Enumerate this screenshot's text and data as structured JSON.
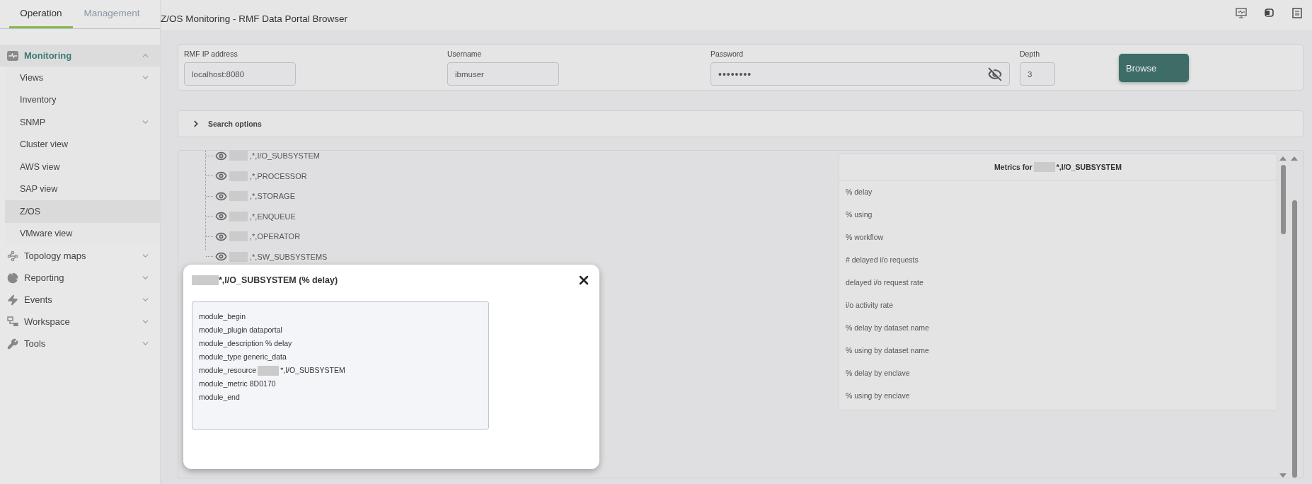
{
  "sidebar": {
    "tabs": [
      {
        "label": "Operation",
        "selected": true
      },
      {
        "label": "Management",
        "selected": false
      }
    ],
    "sections": [
      {
        "label": "Monitoring",
        "expanded": true,
        "children": [
          {
            "label": "Views",
            "has_children": true,
            "selected": false
          },
          {
            "label": "Inventory",
            "has_children": false,
            "selected": false
          },
          {
            "label": "SNMP",
            "has_children": true,
            "selected": false
          },
          {
            "label": "Cluster view",
            "has_children": false,
            "selected": false
          },
          {
            "label": "AWS view",
            "has_children": false,
            "selected": false
          },
          {
            "label": "SAP view",
            "has_children": false,
            "selected": false
          },
          {
            "label": "Z/OS",
            "has_children": false,
            "selected": true
          },
          {
            "label": "VMware view",
            "has_children": false,
            "selected": false
          }
        ]
      },
      {
        "label": "Topology maps",
        "expanded": false
      },
      {
        "label": "Reporting",
        "expanded": false
      },
      {
        "label": "Events",
        "expanded": false
      },
      {
        "label": "Workspace",
        "expanded": false
      },
      {
        "label": "Tools",
        "expanded": false
      }
    ]
  },
  "page_title": "Z/OS Monitoring - RMF Data Portal Browser",
  "form": {
    "fields": [
      {
        "label": "RMF IP address",
        "value": "localhost:8080",
        "kind": "text"
      },
      {
        "label": "Username",
        "value": "ibmuser",
        "kind": "text"
      },
      {
        "label": "Password",
        "value": "••••••••",
        "kind": "password"
      },
      {
        "label": "Depth",
        "value": "3",
        "kind": "number"
      }
    ],
    "button": "Browse"
  },
  "search_options": {
    "label": "Search options",
    "expanded": false
  },
  "tree": [
    {
      "label": ",*,I/O_SUBSYSTEM",
      "redacted": true
    },
    {
      "label": ",*,PROCESSOR",
      "redacted": true
    },
    {
      "label": ",*,STORAGE",
      "redacted": true
    },
    {
      "label": ",*,ENQUEUE",
      "redacted": true
    },
    {
      "label": ",*,OPERATOR",
      "redacted": true
    },
    {
      "label": ",*,SW_SUBSYSTEMS",
      "redacted": true
    }
  ],
  "metrics": {
    "title_prefix": "Metrics for",
    "title_suffix": "*,I/O_SUBSYSTEM",
    "items": [
      "% delay",
      "% using",
      "% workflow",
      "# delayed i/o requests",
      "delayed i/o request rate",
      "i/o activity rate",
      "% delay by dataset name",
      "% using by dataset name",
      "% delay by enclave",
      "% using by enclave"
    ]
  },
  "dialog": {
    "title": "*,I/O_SUBSYSTEM (% delay)",
    "lines": [
      {
        "text": "module_begin"
      },
      {
        "text": "module_plugin dataportal"
      },
      {
        "text": "module_description % delay"
      },
      {
        "text": "module_type generic_data"
      },
      {
        "text": "module_resource",
        "redacted_after": true,
        "rest": "*,I/O_SUBSYSTEM"
      },
      {
        "text": "module_metric 8D0170"
      },
      {
        "text": "module_end"
      }
    ]
  }
}
